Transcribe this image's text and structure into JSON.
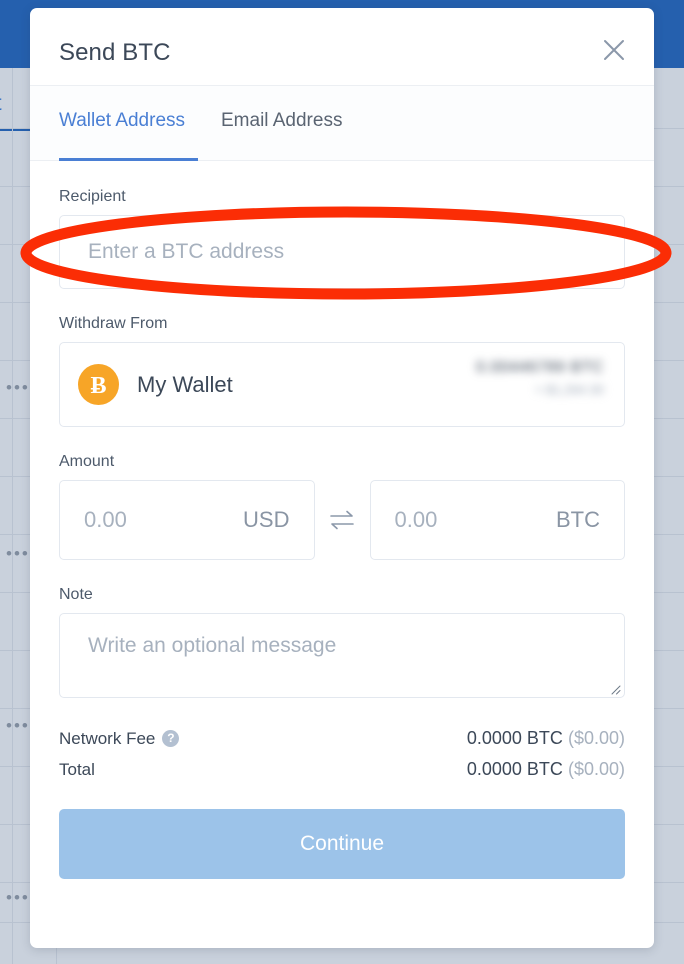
{
  "background": {
    "nav_label": "unt",
    "row_menu_glyph": "•••"
  },
  "modal": {
    "title": "Send BTC",
    "close_icon": "close-icon",
    "tabs": [
      {
        "label": "Wallet Address",
        "active": true
      },
      {
        "label": "Email Address",
        "active": false
      }
    ],
    "recipient": {
      "label": "Recipient",
      "value": "",
      "placeholder": "Enter a BTC address"
    },
    "withdraw_from": {
      "label": "Withdraw From",
      "wallet_name": "My Wallet",
      "coin_icon": "bitcoin-icon",
      "coin_symbol": "Ƀ",
      "coin_color": "#f7a527",
      "balance_primary": "0.00446789 BTC",
      "balance_secondary": "≈ $1,264.30",
      "balance_redacted": true
    },
    "amount": {
      "label": "Amount",
      "fiat": {
        "value": "",
        "placeholder": "0.00",
        "currency": "USD"
      },
      "crypto": {
        "value": "",
        "placeholder": "0.00",
        "currency": "BTC"
      },
      "swap_icon": "swap-arrows-icon"
    },
    "note": {
      "label": "Note",
      "value": "",
      "placeholder": "Write an optional message",
      "resize_handle_icon": "resize-handle-icon"
    },
    "summary": [
      {
        "label": "Network Fee",
        "help_icon": "help-icon",
        "help_glyph": "?",
        "amount": "0.0000 BTC",
        "fiat": "($0.00)"
      },
      {
        "label": "Total",
        "help_icon": null,
        "help_glyph": "",
        "amount": "0.0000 BTC",
        "fiat": "($0.00)"
      }
    ],
    "continue_label": "Continue"
  },
  "annotation": {
    "shape": "ellipse",
    "color": "#fb2d05",
    "target": "recipient-input"
  },
  "colors": {
    "topbar_blue": "#2560ae",
    "accent_blue": "#4a7fd4",
    "button_blue": "#9cc3e9",
    "bitcoin_orange": "#f7a527",
    "annotation_red": "#fb2d05",
    "page_dim": "#c9d1dc"
  }
}
